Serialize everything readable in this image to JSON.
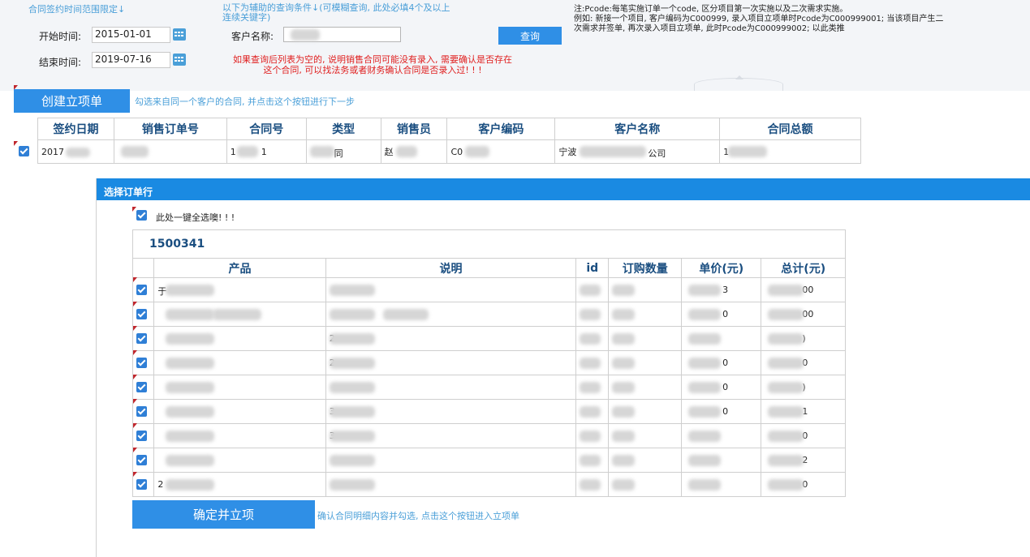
{
  "search": {
    "range_note": "合同签约时间范围限定↓",
    "aux_note_line1": "以下为辅助的查询条件↓(可模糊查询, 此处必填4个及以上",
    "aux_note_line2": "连续关键字)",
    "start_label": "开始时间:",
    "start_value": "2015-01-01",
    "end_label": "结束时间:",
    "end_value": "2019-07-16",
    "customer_label": "客户名称:",
    "query_button": "查询",
    "empty_warning_line1": "如果查询后列表为空的, 说明销售合同可能没有录入, 需要确认是否存在",
    "empty_warning_line2": "这个合同, 可以找法务或者财务确认合同是否录入过! ! !",
    "pcode_note_line1": "注:Pcode:每笔实施订单一个code, 区分项目第一次实施以及二次需求实施。",
    "pcode_note_line2": "例如: 新接一个项目, 客户编码为C000999, 录入项目立项单时Pcode为C000999001; 当该项目产生二",
    "pcode_note_line3": "次需求并签单, 再次录入项目立项单, 此时Pcode为C000999002; 以此类推"
  },
  "create": {
    "button": "创建立项单",
    "hint": "勾选来自同一个客户的合同, 并点击这个按钮进行下一步"
  },
  "contracts": {
    "headers": [
      "签约日期",
      "销售订单号",
      "合同号",
      "类型",
      "销售员",
      "客户编码",
      "客户名称",
      "合同总额"
    ],
    "row": {
      "date": "2017",
      "order_no": "",
      "contract_no_a": "1",
      "contract_no_b": "1",
      "type": "同",
      "salesperson": "赵",
      "customer_code": "C0",
      "customer_name_a": "宁波",
      "customer_name_b": "公司",
      "total": "1"
    }
  },
  "dialog": {
    "title": "选择订单行",
    "select_all": "此处一键全选噢! ! !",
    "order_no": "1500341",
    "headers": [
      "产品",
      "说明",
      "id",
      "订购数量",
      "单价(元)",
      "总计(元)"
    ],
    "rows": [
      {
        "product": "于",
        "desc": "",
        "price": "3",
        "total": "00"
      },
      {
        "product": "",
        "desc": "",
        "price": "0",
        "total": "00"
      },
      {
        "product": "",
        "desc": "2",
        "price": "",
        "total": ")"
      },
      {
        "product": "",
        "desc": "2",
        "price": "0",
        "total": "0"
      },
      {
        "product": "",
        "desc": "",
        "price": "0",
        "total": ")"
      },
      {
        "product": "",
        "desc": "3",
        "price": "0",
        "total": "1"
      },
      {
        "product": "",
        "desc": "3",
        "price": "",
        "total": "0"
      },
      {
        "product": "",
        "desc": "",
        "price": "",
        "total": "2"
      },
      {
        "product": "2",
        "desc": "",
        "price": "",
        "total": "0"
      }
    ],
    "confirm_button": "确定并立项",
    "confirm_hint": "确认合同明细内容并勾选, 点击这个按钮进入立项单"
  }
}
